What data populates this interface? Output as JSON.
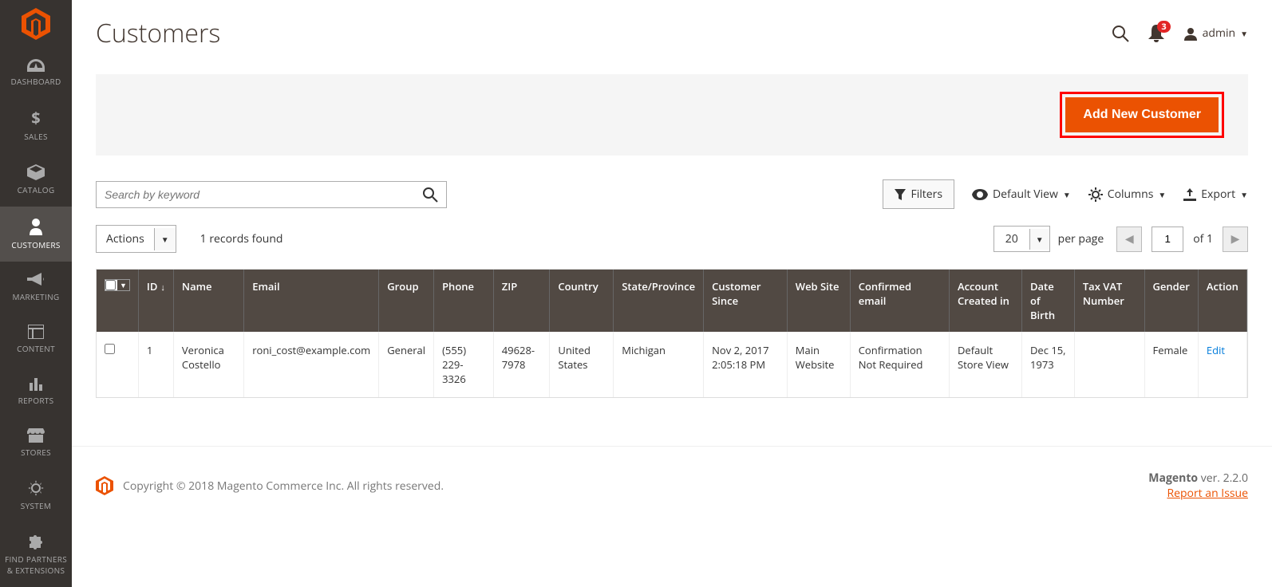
{
  "sidebar": {
    "items": [
      {
        "label": "DASHBOARD"
      },
      {
        "label": "SALES"
      },
      {
        "label": "CATALOG"
      },
      {
        "label": "CUSTOMERS"
      },
      {
        "label": "MARKETING"
      },
      {
        "label": "CONTENT"
      },
      {
        "label": "REPORTS"
      },
      {
        "label": "STORES"
      },
      {
        "label": "SYSTEM"
      },
      {
        "label": "FIND PARTNERS & EXTENSIONS"
      }
    ]
  },
  "header": {
    "title": "Customers",
    "notification_count": "3",
    "admin_label": "admin"
  },
  "actionbar": {
    "add_label": "Add New Customer"
  },
  "toolbar": {
    "search_placeholder": "Search by keyword",
    "filters_label": "Filters",
    "default_view_label": "Default View",
    "columns_label": "Columns",
    "export_label": "Export"
  },
  "row2": {
    "actions_label": "Actions",
    "records_found": "1 records found",
    "perpage_value": "20",
    "perpage_label": "per page",
    "page_value": "1",
    "page_total": "of 1"
  },
  "grid": {
    "headers": {
      "id": "ID",
      "name": "Name",
      "email": "Email",
      "group": "Group",
      "phone": "Phone",
      "zip": "ZIP",
      "country": "Country",
      "state": "State/Province",
      "since": "Customer Since",
      "website": "Web Site",
      "confirmed": "Confirmed email",
      "created_in": "Account Created in",
      "dob": "Date of Birth",
      "tax_vat": "Tax VAT Number",
      "gender": "Gender",
      "action": "Action"
    },
    "rows": [
      {
        "id": "1",
        "name": "Veronica Costello",
        "email": "roni_cost@example.com",
        "group": "General",
        "phone": "(555) 229-3326",
        "zip": "49628-7978",
        "country": "United States",
        "state": "Michigan",
        "since": "Nov 2, 2017 2:05:18 PM",
        "website": "Main Website",
        "confirmed": "Confirmation Not Required",
        "created_in": "Default Store View",
        "dob": "Dec 15, 1973",
        "tax_vat": "",
        "gender": "Female",
        "action": "Edit"
      }
    ]
  },
  "footer": {
    "copyright": "Copyright © 2018 Magento Commerce Inc. All rights reserved.",
    "version_prefix": "Magento",
    "version": " ver. 2.2.0",
    "report_link": "Report an Issue"
  }
}
